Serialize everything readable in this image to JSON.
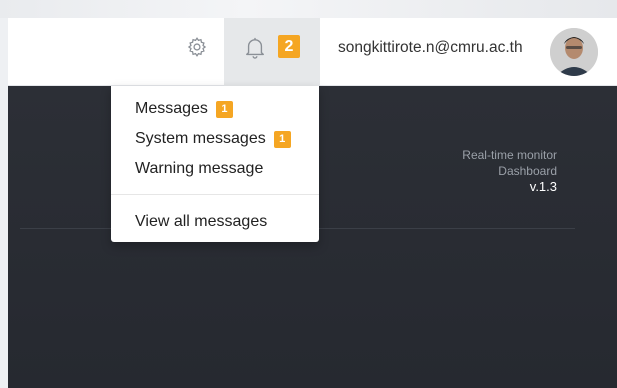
{
  "topbar": {
    "settings_icon": "gear-icon",
    "notifications": {
      "icon": "bell-icon",
      "count": "2"
    },
    "user_email": "songkittirote.n@cmru.ac.th",
    "avatar_icon": "user-avatar"
  },
  "dropdown": {
    "items": [
      {
        "label": "Messages",
        "badge": "1"
      },
      {
        "label": "System messages",
        "badge": "1"
      },
      {
        "label": "Warning message"
      }
    ],
    "view_all": "View all messages"
  },
  "info": {
    "line1": "Real-time monitor",
    "line2": "Dashboard",
    "version": "v.1.3"
  },
  "colors": {
    "badge": "#f5a623",
    "main_bg": "#2c2f36"
  }
}
